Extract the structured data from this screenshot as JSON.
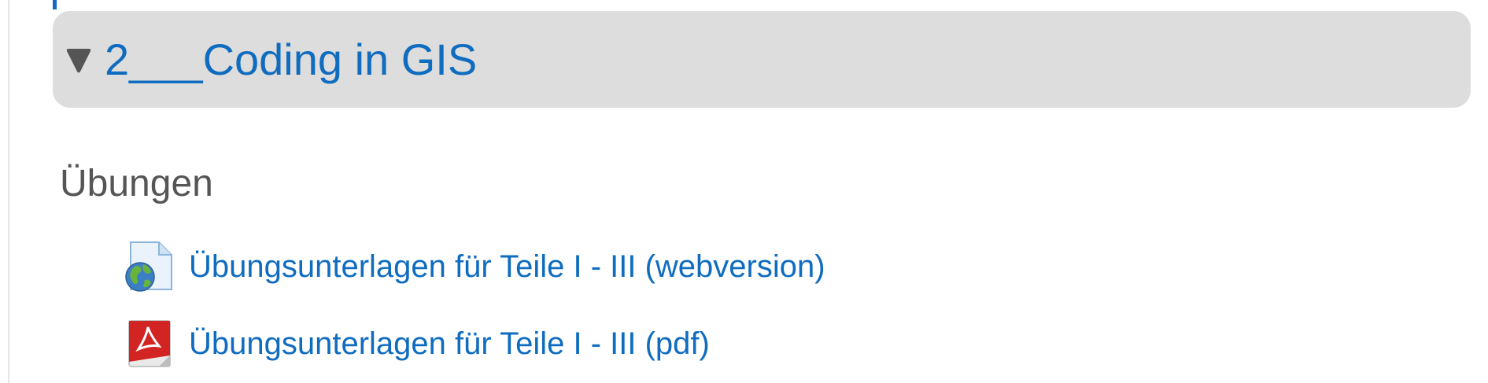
{
  "section": {
    "title": "2___Coding in GIS",
    "toggle_icon": "caret-down-icon"
  },
  "subsection": {
    "heading": "Übungen"
  },
  "activities": [
    {
      "label": "Übungsunterlagen für Teile I - III (webversion)",
      "icon": "web-page-globe-icon"
    },
    {
      "label": "Übungsunterlagen für Teile I - III (pdf)",
      "icon": "pdf-file-icon"
    }
  ],
  "colors": {
    "link": "#0f6cbf",
    "header_bg": "#dddddd",
    "heading_text": "#555555"
  }
}
